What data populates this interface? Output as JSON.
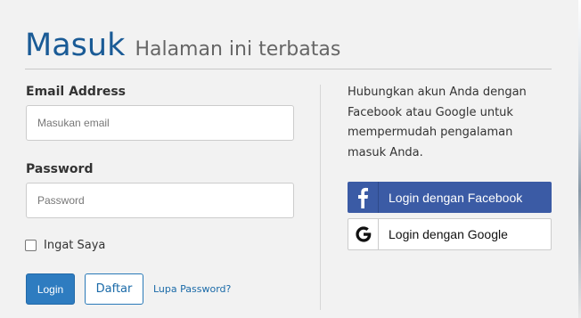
{
  "header": {
    "title": "Masuk",
    "subtitle": "Halaman ini terbatas"
  },
  "form": {
    "email_label": "Email Address",
    "email_placeholder": "Masukan email",
    "email_value": "",
    "password_label": "Password",
    "password_placeholder": "Password",
    "password_value": "",
    "remember_label": "Ingat Saya",
    "remember_checked": false,
    "login_button": "Login",
    "register_button": "Daftar",
    "forgot_link": "Lupa Password?"
  },
  "social": {
    "description": "Hubungkan akun Anda dengan Facebook atau Google untuk mempermudah pengalaman masuk Anda.",
    "facebook_button": "Login dengan Facebook",
    "google_button": "Login dengan Google",
    "facebook_icon": "facebook-icon",
    "google_icon": "google-icon"
  },
  "colors": {
    "brand_blue": "#1a5b96",
    "primary_button": "#2e7cc0",
    "facebook": "#3b5ba5"
  }
}
